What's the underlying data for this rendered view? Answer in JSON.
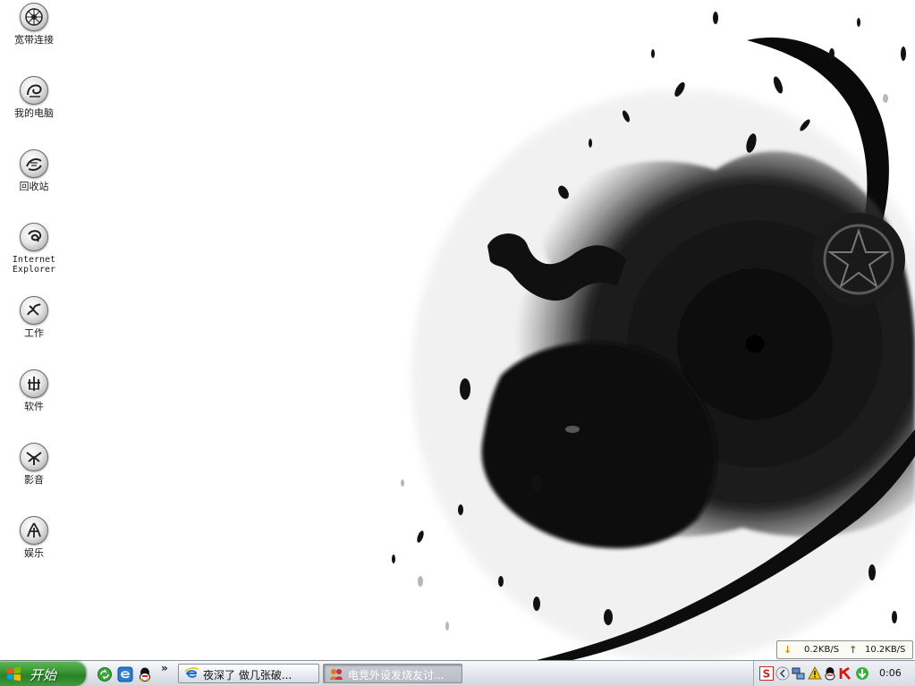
{
  "desktop": {
    "icons": [
      {
        "name": "broadband-connection",
        "label": "宽带连接"
      },
      {
        "name": "my-computer",
        "label": "我的电脑"
      },
      {
        "name": "recycle-bin",
        "label": "回收站"
      },
      {
        "name": "internet-explorer",
        "label_line1": "Internet",
        "label_line2": "Explorer"
      },
      {
        "name": "work-folder",
        "label": "工作"
      },
      {
        "name": "software-folder",
        "label": "软件"
      },
      {
        "name": "media-folder",
        "label": "影音"
      },
      {
        "name": "entertainment-folder",
        "label": "娱乐"
      }
    ]
  },
  "net_meter": {
    "download": "0.2KB/S",
    "upload": "10.2KB/S",
    "download_arrow": "↓",
    "upload_arrow": "↑",
    "colors": {
      "download_arrow": "#d08a00",
      "upload_arrow": "#2e8b2e"
    }
  },
  "taskbar": {
    "start_label": "开始",
    "quicklaunch_more": "»",
    "quicklaunch": [
      "show-desktop-icon",
      "ie-quicklaunch-icon",
      "qq-quicklaunch-icon"
    ],
    "tasks": [
      {
        "label": "夜深了 做几张破...",
        "icon": "ie-icon",
        "active": false
      },
      {
        "label": "电竞外设发烧友讨...",
        "icon": "forum-icon",
        "active": true
      }
    ],
    "tray": {
      "icons": [
        "sogou-input-icon",
        "tray-expand-icon",
        "network-icon",
        "security-icon",
        "qq-tray-icon",
        "antivirus-k-icon",
        "update-icon"
      ],
      "clock": "0:06"
    },
    "colors": {
      "start_green": "#3a9a35",
      "taskbar_silver": "#d2d6dd"
    }
  }
}
